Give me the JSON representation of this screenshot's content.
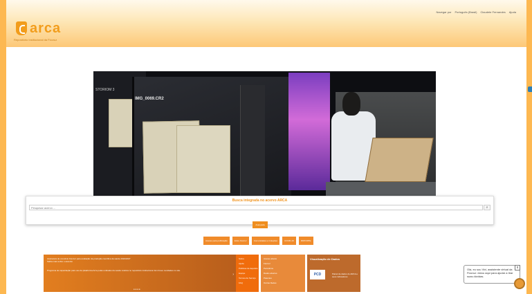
{
  "header": {
    "logo_text": "arca",
    "subtitle": "Repositório Institucional da Fiocruz",
    "nav": [
      "Navegar por",
      "Português (Brasil)",
      "Claudete Fernandes",
      "Ajuda"
    ]
  },
  "hero": {
    "image_name": "IMG_0069.CR2",
    "room": "STORIOM 3"
  },
  "search": {
    "title": "Busca integrada no acervo ARCA",
    "placeholder": "Pesquisar acervo ...",
    "button_icon": "search-icon"
  },
  "advanced_label": "Avançada",
  "quick_links": [
    "Acesso para publicação",
    "Entre Fiocruz",
    "Comunidades e Coleções",
    "COVID-19",
    "RDPORTE"
  ],
  "news": {
    "line1": "Assinatura de convênio Fiocruz para avaliação da produção científica da saúde 2024/2027",
    "line2": "Saiba mais sobre o assunto",
    "line3": "Programa de capacitação para uso da plataforma Arca pelas unidades da saúde coletiva no repositório institucional. Em breve novidades no site.",
    "arrow": "›",
    "dots": "● ● ● ●"
  },
  "links1": [
    "Sobre",
    "Ajuda",
    "Políticas de depósito",
    "Equipe",
    "Termos de Serviço",
    "FAQ"
  ],
  "links2": [
    "Acesso aberto",
    "Fiocruz",
    "Periódicos",
    "Dados abertos",
    "Patentes",
    "Outras Redes"
  ],
  "dataviz": {
    "title": "Visualização de Dados",
    "logo": "PCD",
    "text": "Painel de dados do ARCA e seus indicadores"
  },
  "chat": {
    "message": "Olá, eu sou Vivi, assistente virtual da Fiocruz: estou aqui para ajudar a tirar suas dúvidas.",
    "close": "x"
  },
  "colors": {
    "accent": "#f29d1c",
    "button": "#ef8e1f"
  }
}
